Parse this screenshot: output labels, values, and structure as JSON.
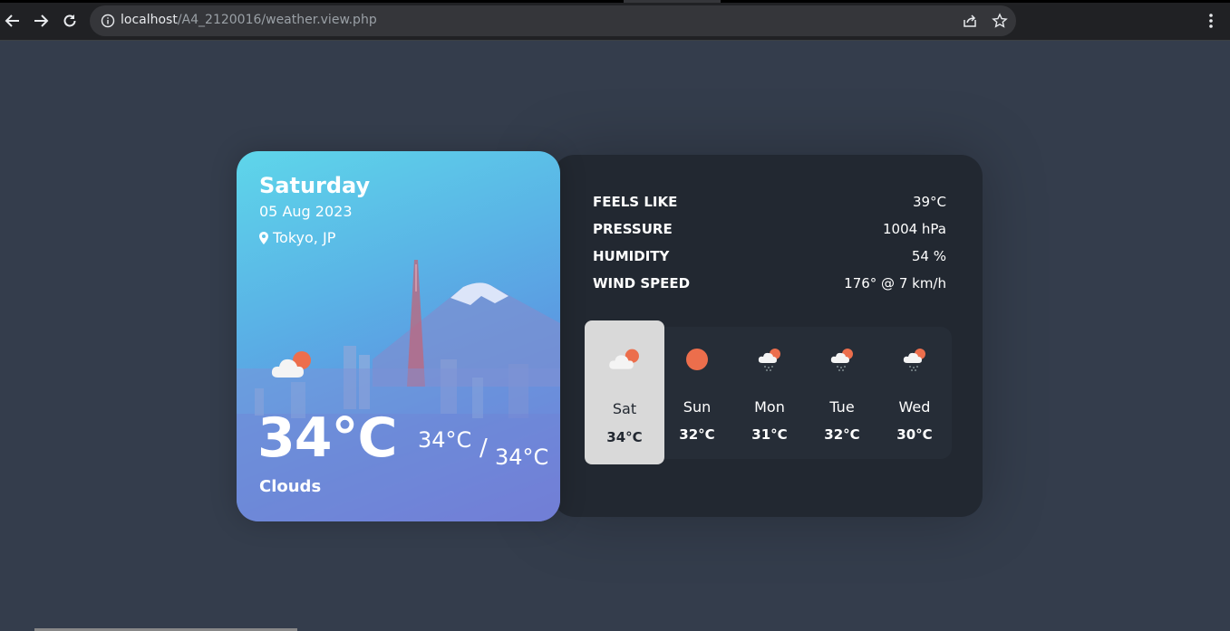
{
  "browser": {
    "url_host": "localhost",
    "url_path": "/A4_2120016/weather.view.php"
  },
  "current": {
    "day": "Saturday",
    "date": "05 Aug 2023",
    "location": "Tokyo, JP",
    "temperature": "34°C",
    "temp_max": "34°C",
    "separator": "/",
    "temp_min": "34°C",
    "condition": "Clouds",
    "icon": "cloud-sun-icon"
  },
  "stats": [
    {
      "label": "FEELS LIKE",
      "value": "39°C"
    },
    {
      "label": "PRESSURE",
      "value": "1004 hPa"
    },
    {
      "label": "HUMIDITY",
      "value": "54 %"
    },
    {
      "label": "WIND SPEED",
      "value": "176° @ 7 km/h"
    }
  ],
  "forecast": [
    {
      "day": "Sat",
      "temp": "34°C",
      "icon": "cloud-sun-icon",
      "active": true
    },
    {
      "day": "Sun",
      "temp": "32°C",
      "icon": "sun-icon",
      "active": false
    },
    {
      "day": "Mon",
      "temp": "31°C",
      "icon": "rain-cloud-sun-icon",
      "active": false
    },
    {
      "day": "Tue",
      "temp": "32°C",
      "icon": "rain-cloud-sun-icon",
      "active": false
    },
    {
      "day": "Wed",
      "temp": "30°C",
      "icon": "rain-cloud-sun-icon",
      "active": false
    }
  ],
  "colors": {
    "page_bg": "#343d4c",
    "panel_bg": "#222831",
    "sun": "#ec6e4c",
    "active_day_bg": "#d9d9d9"
  }
}
